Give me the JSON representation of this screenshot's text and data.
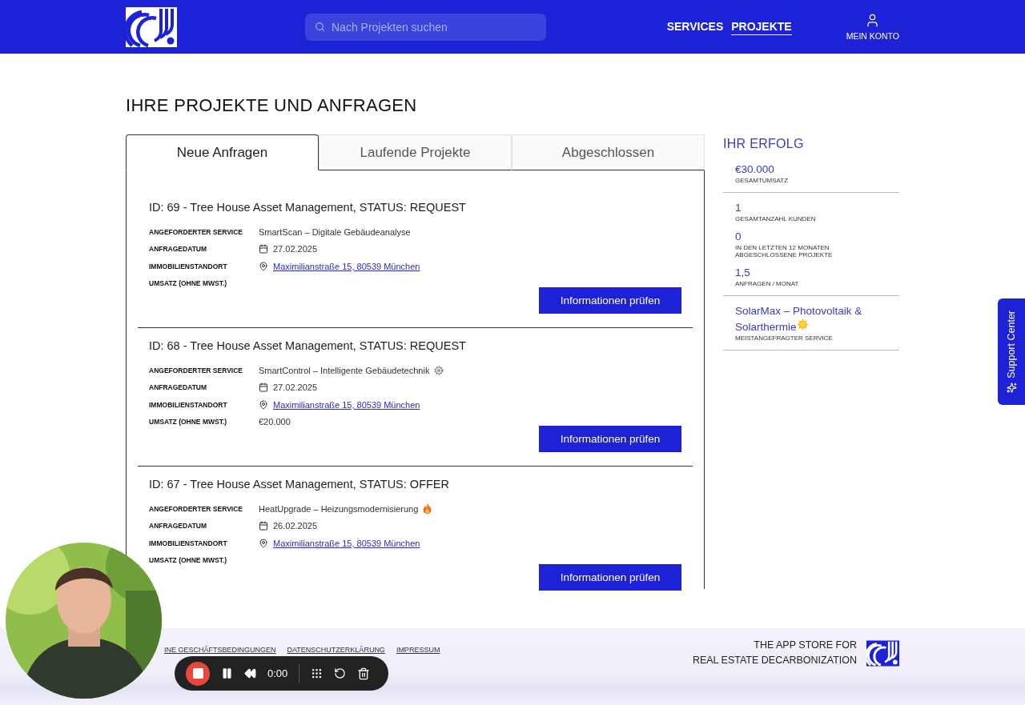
{
  "header": {
    "search": {
      "placeholder": "Nach Projekten suchen"
    },
    "nav": [
      {
        "label": "SERVICES",
        "selected": false
      },
      {
        "label": "PROJEKTE",
        "selected": true
      }
    ],
    "account": "MEIN KONTO"
  },
  "page_title": "IHRE PROJEKTE UND ANFRAGEN",
  "tabs": [
    {
      "label": "Neue Anfragen",
      "selected": true
    },
    {
      "label": "Laufende Projekte",
      "selected": false
    },
    {
      "label": "Abgeschlossen",
      "selected": false
    }
  ],
  "projects": [
    {
      "title": "ID: 69 - Tree House Asset Management, STATUS: REQUEST",
      "fields": [
        {
          "label": "ANGEFORDERTER SERVICE",
          "kind": "text",
          "value": "SmartScan – Digitale Gebäudeanalyse"
        },
        {
          "label": "ANFRAGEDATUM",
          "kind": "date",
          "value": "27.02.2025"
        },
        {
          "label": "IMMOBILIENSTANDORT",
          "kind": "location",
          "value": "Maximilianstraße 15, 80539 München"
        },
        {
          "label": "UMSATZ (OHNE MWST.)",
          "kind": "empty"
        }
      ],
      "button": "Informationen prüfen"
    },
    {
      "title": "ID: 68 - Tree House Asset Management, STATUS: REQUEST",
      "fields": [
        {
          "label": "ANGEFORDERTER SERVICE",
          "kind": "gear",
          "value": "SmartControl – Intelligente Gebäudetechnik"
        },
        {
          "label": "ANFRAGEDATUM",
          "kind": "date",
          "value": "27.02.2025"
        },
        {
          "label": "IMMOBILIENSTANDORT",
          "kind": "location",
          "value": "Maximilianstraße 15, 80539 München"
        },
        {
          "label": "UMSATZ (OHNE MWST.)",
          "kind": "text",
          "value": "€20.000"
        }
      ],
      "button": "Informationen prüfen"
    },
    {
      "title": "ID: 67 - Tree House Asset Management, STATUS: OFFER",
      "fields": [
        {
          "label": "ANGEFORDERTER SERVICE",
          "kind": "fire",
          "value": "HeatUpgrade – Heizungsmodernisierung"
        },
        {
          "label": "ANFRAGEDATUM",
          "kind": "date",
          "value": "26.02.2025"
        },
        {
          "label": "IMMOBILIENSTANDORT",
          "kind": "location",
          "value": "Maximilianstraße 15, 80539 München"
        },
        {
          "label": "UMSATZ (OHNE MWST.)",
          "kind": "empty"
        }
      ],
      "button": "Informationen prüfen"
    }
  ],
  "sidebar": {
    "title": "IHR ERFOLG",
    "groups": [
      [
        {
          "value": "€30.000",
          "label": "GESAMTUMSATZ"
        }
      ],
      [
        {
          "value": "1",
          "label": "GESAMTANZAHL KUNDEN"
        },
        {
          "value": "0",
          "label": "IN DEN LETZTEN 12 MONATEN ABGESCHLOSSENE PROJEKTE"
        },
        {
          "value": "1,5",
          "label": "ANFRAGEN / MONAT"
        }
      ],
      [
        {
          "value": "SolarMax – Photovoltaik & Solarthermie",
          "kind": "sun",
          "label": "MEISTANGEFRAGTER SERVICE"
        }
      ]
    ]
  },
  "support_tab": "Support Center",
  "footer": {
    "links": [
      "INE GESCHÄFTSBEDINGUNGEN",
      "DATENSCHUTZERKLÄRUNG",
      "IMPRESSUM"
    ],
    "tagline": [
      "THE APP STORE FOR",
      "REAL ESTATE DECARBONIZATION"
    ]
  },
  "recorder": {
    "time": "0:00"
  }
}
